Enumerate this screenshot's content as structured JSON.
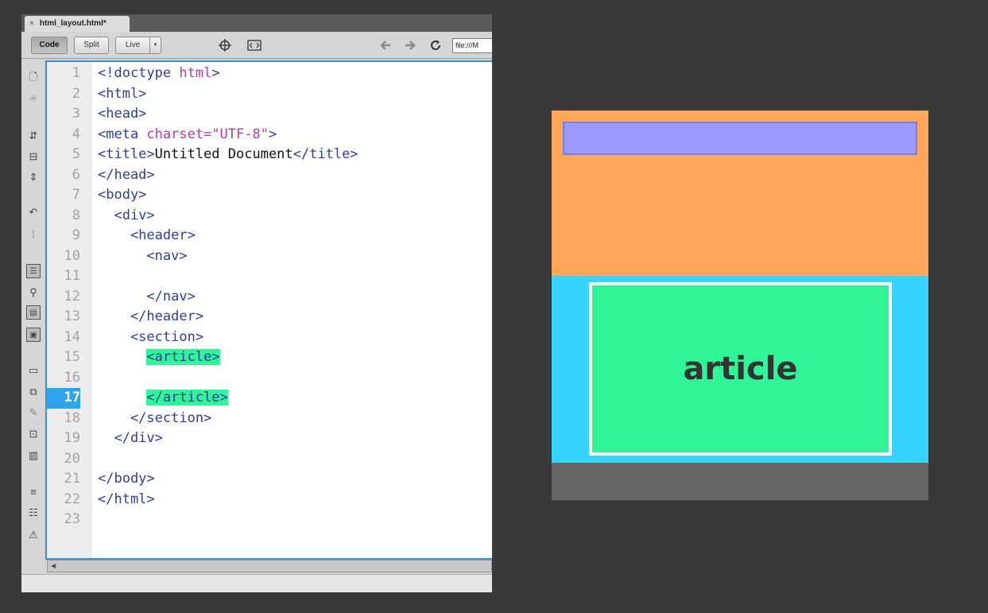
{
  "editor": {
    "tab_title": "html_layout.html*",
    "tab_close": "×",
    "toolbar": {
      "code_label": "Code",
      "split_label": "Split",
      "live_label": "Live",
      "live_caret": "▾",
      "url_value": "file:///M"
    },
    "current_line": 17,
    "line_numbers": [
      "1",
      "2",
      "3",
      "4",
      "5",
      "6",
      "7",
      "8",
      "9",
      "10",
      "11",
      "12",
      "13",
      "14",
      "15",
      "16",
      "17",
      "18",
      "19",
      "20",
      "21",
      "22",
      "23"
    ],
    "code": {
      "l1a": "<!doctype ",
      "l1b": "html",
      "l1c": ">",
      "l2": "<html>",
      "l3": "<head>",
      "l4a": "<meta ",
      "l4b": "charset=\"UTF-8\"",
      "l4c": ">",
      "l5a": "<title>",
      "l5b": "Untitled Document",
      "l5c": "</title>",
      "l6": "</head>",
      "l7": "<body>",
      "l8": "  <div>",
      "l9": "    <header>",
      "l10": "      <nav>",
      "l12": "      </nav>",
      "l13": "    </header>",
      "l14": "    <section>",
      "l15": "<article>",
      "l17": "</article>",
      "l18": "    </section>",
      "l19": "  </div>",
      "l21": "</body>",
      "l22": "</html>"
    }
  },
  "preview": {
    "article_label": "article",
    "colors": {
      "header": "#fea75b",
      "nav": "#9b9bff",
      "section": "#36d3fc",
      "article": "#2ff596",
      "footer": "#666666"
    }
  },
  "icons": {
    "toolbar": [
      "inspect-icon",
      "code-navigator-icon",
      "back-arrow-icon",
      "forward-arrow-icon",
      "refresh-icon"
    ],
    "sidebar": [
      "open-documents-icon",
      "collapse-tag-icon",
      "expand-icon",
      "select-parent-icon",
      "balance-braces-icon",
      "line-numbers-icon",
      "highlight-invalid-icon",
      "syntax-coloring-icon",
      "auto-indent-icon",
      "comment-icon",
      "uncomment-icon",
      "wrap-tag-icon",
      "recent-snippets-icon",
      "move-css-icon",
      "indent-icon",
      "outdent-icon",
      "format-source-icon"
    ]
  }
}
